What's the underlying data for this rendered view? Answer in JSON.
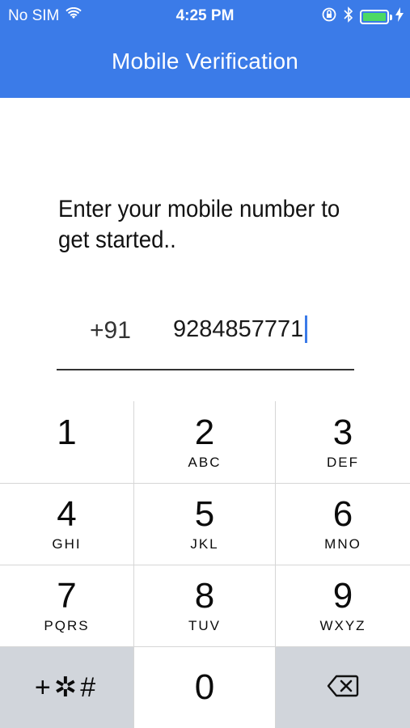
{
  "status_bar": {
    "carrier": "No SIM",
    "time": "4:25 PM",
    "wifi_icon": "wifi-icon",
    "orientation_lock_icon": "orientation-lock-icon",
    "bluetooth_icon": "bluetooth-icon",
    "battery_icon": "battery-icon",
    "charging_icon": "charging-bolt-icon",
    "battery_level": 1.0
  },
  "header": {
    "title": "Mobile Verification",
    "background_color": "#3b7be8"
  },
  "prompt": {
    "line1": "Enter your mobile number to",
    "line2": "get started.."
  },
  "phone": {
    "country_code": "+91",
    "number": "9284857771"
  },
  "keypad": {
    "keys": [
      {
        "digit": "1",
        "letters": ""
      },
      {
        "digit": "2",
        "letters": "ABC"
      },
      {
        "digit": "3",
        "letters": "DEF"
      },
      {
        "digit": "4",
        "letters": "GHI"
      },
      {
        "digit": "5",
        "letters": "JKL"
      },
      {
        "digit": "6",
        "letters": "MNO"
      },
      {
        "digit": "7",
        "letters": "PQRS"
      },
      {
        "digit": "8",
        "letters": "TUV"
      },
      {
        "digit": "9",
        "letters": "WXYZ"
      },
      {
        "digit": "0",
        "letters": ""
      }
    ],
    "symbols_label": "+✲#",
    "delete_icon": "backspace-icon"
  }
}
